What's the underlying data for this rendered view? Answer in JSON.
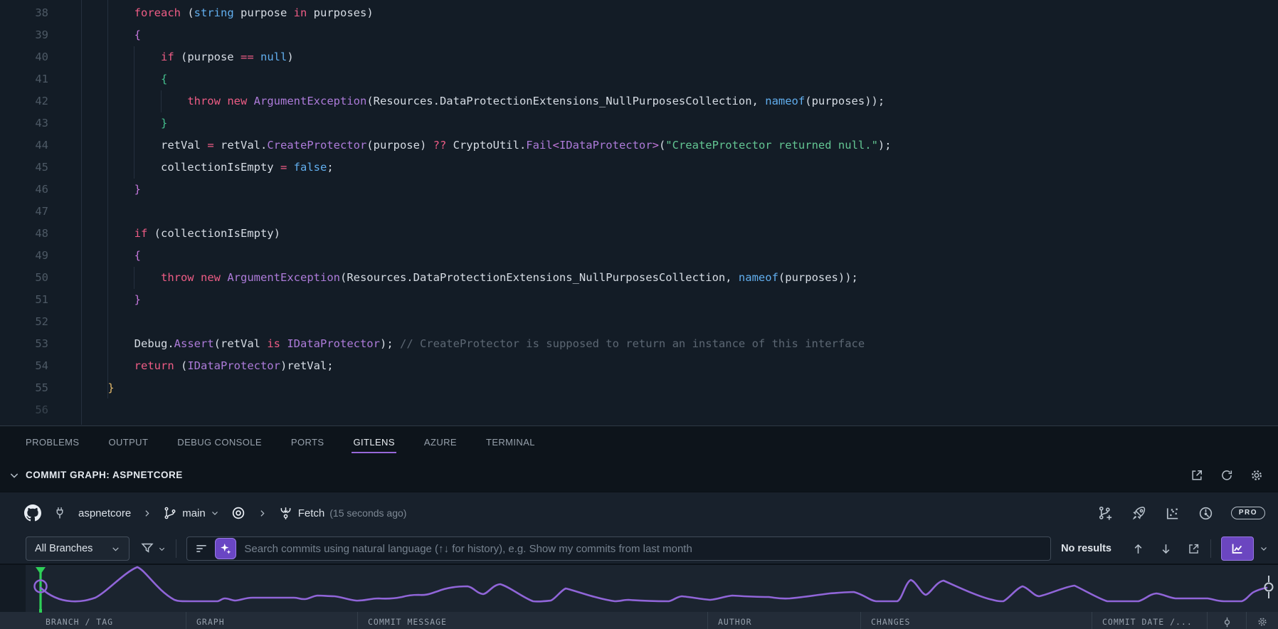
{
  "editor": {
    "code_lines": [
      {
        "n": "38",
        "tokens": [
          [
            "p",
            "        "
          ],
          [
            "k",
            "foreach"
          ],
          [
            "p",
            " ("
          ],
          [
            "b",
            "string"
          ],
          [
            "p",
            " purpose "
          ],
          [
            "k",
            "in"
          ],
          [
            "p",
            " purposes)"
          ]
        ]
      },
      {
        "n": "39",
        "tokens": [
          [
            "p",
            "        "
          ],
          [
            "m",
            "{"
          ]
        ]
      },
      {
        "n": "40",
        "tokens": [
          [
            "p",
            "            "
          ],
          [
            "k",
            "if"
          ],
          [
            "p",
            " (purpose "
          ],
          [
            "k",
            "=="
          ],
          [
            "p",
            " "
          ],
          [
            "b",
            "null"
          ],
          [
            "p",
            ")"
          ]
        ]
      },
      {
        "n": "41",
        "tokens": [
          [
            "p",
            "            "
          ],
          [
            "g",
            "{"
          ]
        ]
      },
      {
        "n": "42",
        "tokens": [
          [
            "p",
            "                "
          ],
          [
            "k",
            "throw"
          ],
          [
            "p",
            " "
          ],
          [
            "k",
            "new"
          ],
          [
            "p",
            " "
          ],
          [
            "t",
            "ArgumentException"
          ],
          [
            "p",
            "(Resources.DataProtectionExtensions_NullPurposesCollection, "
          ],
          [
            "b",
            "nameof"
          ],
          [
            "p",
            "(purposes));"
          ]
        ]
      },
      {
        "n": "43",
        "tokens": [
          [
            "p",
            "            "
          ],
          [
            "g",
            "}"
          ]
        ]
      },
      {
        "n": "44",
        "tokens": [
          [
            "p",
            "            retVal "
          ],
          [
            "k",
            "="
          ],
          [
            "p",
            " retVal."
          ],
          [
            "t",
            "CreateProtector"
          ],
          [
            "p",
            "(purpose) "
          ],
          [
            "k",
            "??"
          ],
          [
            "p",
            " CryptoUtil."
          ],
          [
            "t",
            "Fail"
          ],
          [
            "m",
            "<"
          ],
          [
            "t",
            "IDataProtector"
          ],
          [
            "m",
            ">"
          ],
          [
            "p",
            "("
          ],
          [
            "s",
            "\"CreateProtector returned null.\""
          ],
          [
            "p",
            ");"
          ]
        ]
      },
      {
        "n": "45",
        "tokens": [
          [
            "p",
            "            collectionIsEmpty "
          ],
          [
            "k",
            "="
          ],
          [
            "p",
            " "
          ],
          [
            "b",
            "false"
          ],
          [
            "p",
            ";"
          ]
        ]
      },
      {
        "n": "46",
        "tokens": [
          [
            "p",
            "        "
          ],
          [
            "m",
            "}"
          ]
        ]
      },
      {
        "n": "47",
        "tokens": []
      },
      {
        "n": "48",
        "tokens": [
          [
            "p",
            "        "
          ],
          [
            "k",
            "if"
          ],
          [
            "p",
            " (collectionIsEmpty)"
          ]
        ]
      },
      {
        "n": "49",
        "tokens": [
          [
            "p",
            "        "
          ],
          [
            "m",
            "{"
          ]
        ]
      },
      {
        "n": "50",
        "tokens": [
          [
            "p",
            "            "
          ],
          [
            "k",
            "throw"
          ],
          [
            "p",
            " "
          ],
          [
            "k",
            "new"
          ],
          [
            "p",
            " "
          ],
          [
            "t",
            "ArgumentException"
          ],
          [
            "p",
            "(Resources.DataProtectionExtensions_NullPurposesCollection, "
          ],
          [
            "b",
            "nameof"
          ],
          [
            "p",
            "(purposes));"
          ]
        ]
      },
      {
        "n": "51",
        "tokens": [
          [
            "p",
            "        "
          ],
          [
            "m",
            "}"
          ]
        ]
      },
      {
        "n": "52",
        "tokens": []
      },
      {
        "n": "53",
        "tokens": [
          [
            "p",
            "        Debug."
          ],
          [
            "t",
            "Assert"
          ],
          [
            "p",
            "(retVal "
          ],
          [
            "k",
            "is"
          ],
          [
            "p",
            " "
          ],
          [
            "t",
            "IDataProtector"
          ],
          [
            "p",
            "); "
          ],
          [
            "c",
            "// CreateProtector is supposed to return an instance of this interface"
          ]
        ]
      },
      {
        "n": "54",
        "tokens": [
          [
            "p",
            "        "
          ],
          [
            "k",
            "return"
          ],
          [
            "p",
            " ("
          ],
          [
            "t",
            "IDataProtector"
          ],
          [
            "p",
            ")retVal;"
          ]
        ]
      },
      {
        "n": "55",
        "tokens": [
          [
            "p",
            "    "
          ],
          [
            "y",
            "}"
          ]
        ]
      },
      {
        "n": "56",
        "dim": true,
        "tokens": []
      }
    ]
  },
  "panel": {
    "tabs": [
      {
        "label": "PROBLEMS",
        "active": false
      },
      {
        "label": "OUTPUT",
        "active": false
      },
      {
        "label": "DEBUG CONSOLE",
        "active": false
      },
      {
        "label": "PORTS",
        "active": false
      },
      {
        "label": "GITLENS",
        "active": true
      },
      {
        "label": "AZURE",
        "active": false
      },
      {
        "label": "TERMINAL",
        "active": false
      }
    ],
    "section": {
      "title": "COMMIT GRAPH: ASPNETCORE"
    },
    "toolbar": {
      "repo": "aspnetcore",
      "branch": "main",
      "fetch_label": "Fetch",
      "fetch_time": "(15 seconds ago)",
      "pro_badge": "PRO"
    },
    "search_bar": {
      "branches_filter": "All Branches",
      "placeholder": "Search commits using natural language (↑↓ for history), e.g. Show my commits from last month",
      "results_text": "No results"
    },
    "table": {
      "columns": [
        "BRANCH / TAG",
        "GRAPH",
        "COMMIT MESSAGE",
        "AUTHOR",
        "CHANGES",
        "COMMIT DATE /..."
      ]
    }
  },
  "colors": {
    "accent_purple": "#8f62d8",
    "tab_underline": "#9768d9",
    "marker_green": "#2ed058",
    "keyword_pink": "#ee5c85",
    "type_purple": "#ad7bd9",
    "literal_blue": "#61aeee",
    "string_green": "#63c693",
    "comment_gray": "#5c6773"
  },
  "icon_names": [
    "collapse-chevron-icon",
    "open-external-icon",
    "refresh-icon",
    "settings-gear-icon",
    "github-logo-icon",
    "plug-icon",
    "chevron-right-icon",
    "git-branch-icon",
    "chevron-down-icon",
    "target-icon",
    "fetch-icon",
    "create-branch-icon",
    "rocket-icon",
    "scatter-chart-icon",
    "commit-graph-icon",
    "filter-funnel-icon",
    "filter-lines-icon",
    "ai-sparkle-icon",
    "arrow-up-icon",
    "arrow-down-icon",
    "line-chart-icon",
    "commit-node-icon",
    "minimap-wave",
    "branch-marker"
  ]
}
